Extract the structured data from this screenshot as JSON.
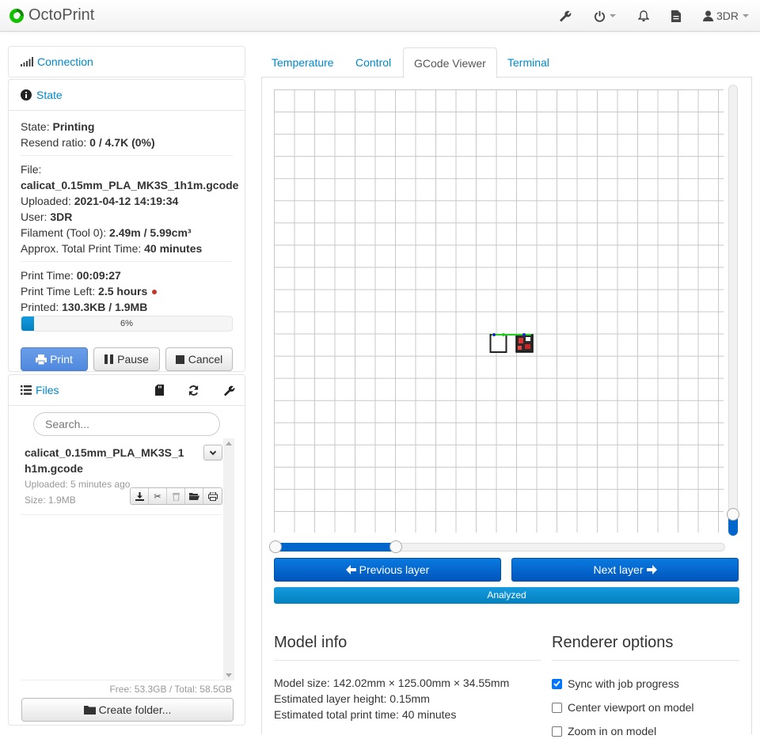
{
  "navbar": {
    "brand": "OctoPrint",
    "user": "3DR",
    "brand_color": "#13c100"
  },
  "connection": {
    "title": "Connection"
  },
  "state": {
    "title": "State",
    "state_label": "State:",
    "state_value": "Printing",
    "resend_label": "Resend ratio:",
    "resend_value": "0 / 4.7K (0%)",
    "file_label": "File:",
    "file_value": "calicat_0.15mm_PLA_MK3S_1h1m.gcode",
    "uploaded_label": "Uploaded:",
    "uploaded_value": "2021-04-12 14:19:34",
    "user_label": "User:",
    "user_value": "3DR",
    "filament_label": "Filament (Tool 0):",
    "filament_value": "2.49m / 5.99cm³",
    "total_time_label": "Approx. Total Print Time:",
    "total_time_value": "40 minutes",
    "print_time_label": "Print Time:",
    "print_time_value": "00:09:27",
    "time_left_label": "Print Time Left:",
    "time_left_value": "2.5 hours",
    "printed_label": "Printed:",
    "printed_value": "130.3KB / 1.9MB",
    "progress_text": "6%",
    "progress_fraction": 0.06,
    "buttons": {
      "print": "Print",
      "pause": "Pause",
      "cancel": "Cancel"
    }
  },
  "files": {
    "title": "Files",
    "search_placeholder": "Search...",
    "items": [
      {
        "name": "calicat_0.15mm_PLA_MK3S_1h1m.gcode",
        "uploaded": "Uploaded: 5 minutes ago",
        "size": "Size: 1.9MB"
      }
    ],
    "free_total": "Free: 53.3GB / Total: 58.5GB",
    "create_folder": "Create folder..."
  },
  "tabs": [
    {
      "label": "Temperature"
    },
    {
      "label": "Control"
    },
    {
      "label": "GCode Viewer",
      "active": true
    },
    {
      "label": "Terminal"
    }
  ],
  "gcode_viewer": {
    "previous_layer": "Previous layer",
    "next_layer": "Next layer",
    "analyzed": "Analyzed",
    "layer_progress_fraction": 0.27,
    "model_info": {
      "title": "Model info",
      "size": "Model size: 142.02mm × 125.00mm × 34.55mm",
      "layer_height": "Estimated layer height: 0.15mm",
      "print_time": "Estimated total print time: 40 minutes"
    },
    "renderer": {
      "title": "Renderer options",
      "options": [
        {
          "label": "Sync with job progress",
          "checked": true
        },
        {
          "label": "Center viewport on model",
          "checked": false
        },
        {
          "label": "Zoom in on model",
          "checked": false
        }
      ]
    }
  }
}
